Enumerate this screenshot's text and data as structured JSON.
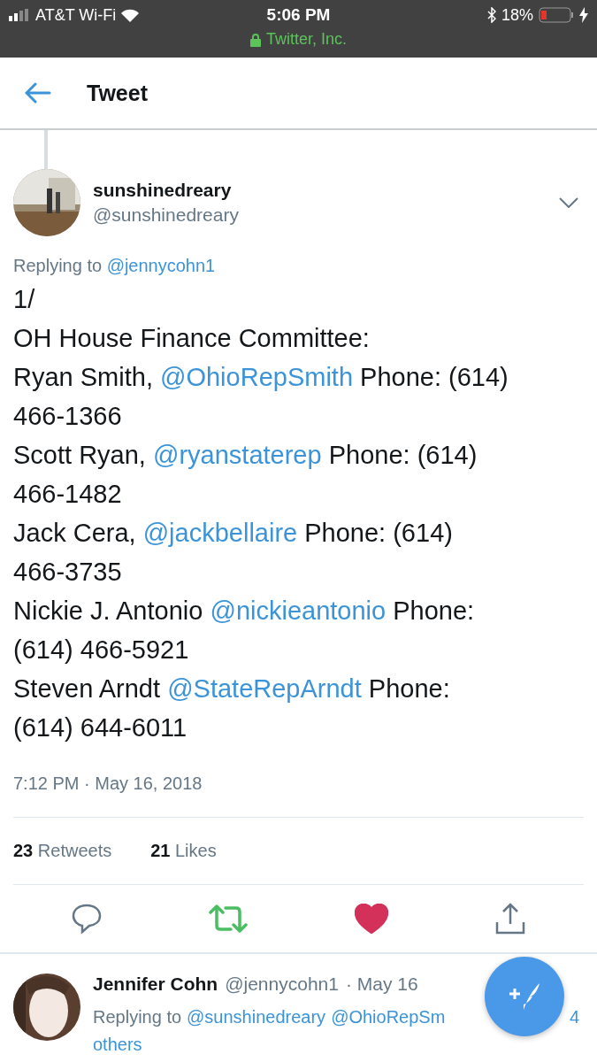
{
  "status_bar": {
    "carrier": "AT&T Wi-Fi",
    "time": "5:06 PM",
    "site": "Twitter, Inc.",
    "battery": "18%"
  },
  "header": {
    "title": "Tweet"
  },
  "tweet": {
    "name": "sunshinedreary",
    "handle": "@sunshinedreary",
    "replying_label": "Replying to",
    "replying_to": "@jennycohn1",
    "lines": [
      [
        {
          "kind": "text",
          "text": "1/"
        }
      ],
      [
        {
          "kind": "text",
          "text": "OH House Finance Committee:"
        }
      ],
      [
        {
          "kind": "text",
          "text": "Ryan Smith, "
        },
        {
          "kind": "mention",
          "text": "@OhioRepSmith"
        },
        {
          "kind": "text",
          "text": " Phone: (614)"
        }
      ],
      [
        {
          "kind": "text",
          "text": "466-1366"
        }
      ],
      [
        {
          "kind": "text",
          "text": "Scott Ryan, "
        },
        {
          "kind": "mention",
          "text": "@ryanstaterep"
        },
        {
          "kind": "text",
          "text": " Phone: (614)"
        }
      ],
      [
        {
          "kind": "text",
          "text": "466-1482"
        }
      ],
      [
        {
          "kind": "text",
          "text": "Jack Cera, "
        },
        {
          "kind": "mention",
          "text": "@jackbellaire"
        },
        {
          "kind": "text",
          "text": " Phone: (614)"
        }
      ],
      [
        {
          "kind": "text",
          "text": "466-3735"
        }
      ],
      [
        {
          "kind": "text",
          "text": "Nickie J. Antonio "
        },
        {
          "kind": "mention",
          "text": "@nickieantonio"
        },
        {
          "kind": "text",
          "text": " Phone:"
        }
      ],
      [
        {
          "kind": "text",
          "text": "(614) 466-5921"
        }
      ],
      [
        {
          "kind": "text",
          "text": "Steven Arndt "
        },
        {
          "kind": "mention",
          "text": "@StateRepArndt"
        },
        {
          "kind": "text",
          "text": " Phone:"
        }
      ],
      [
        {
          "kind": "text",
          "text": "(614) 644-6011"
        }
      ]
    ],
    "timestamp": "7:12 PM · May 16, 2018",
    "stats": [
      {
        "count": "23",
        "label": "Retweets"
      },
      {
        "count": "21",
        "label": "Likes"
      }
    ],
    "retweeted": true,
    "liked": true
  },
  "reply": {
    "name": "Jennifer Cohn",
    "handle": "@jennycohn1",
    "date": "· May 16",
    "replying_label": "Replying to",
    "mentions": [
      "@sunshinedreary",
      "@OhioRepSm"
    ],
    "more_count": "4",
    "more_label": "others"
  }
}
